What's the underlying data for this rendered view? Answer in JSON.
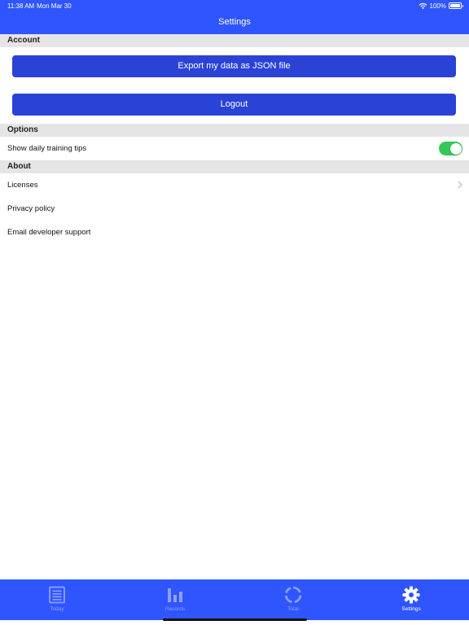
{
  "status_bar": {
    "time": "11:38 AM",
    "date": "Mon Mar 30",
    "battery": "100%",
    "battery_level": 1.0
  },
  "nav": {
    "title": "Settings"
  },
  "sections": {
    "account": {
      "header": "Account",
      "export_button": "Export my data as JSON file",
      "logout_button": "Logout"
    },
    "options": {
      "header": "Options",
      "daily_tips_label": "Show daily training tips",
      "daily_tips_enabled": true
    },
    "about": {
      "header": "About",
      "licenses": "Licenses",
      "privacy": "Privacy policy",
      "email_support": "Email developer support"
    }
  },
  "tabbar": {
    "today": "Today",
    "records": "Records",
    "total": "Total",
    "settings": "Settings",
    "active": "settings"
  },
  "colors": {
    "brand": "#2f55ff",
    "button": "#2a43d6",
    "toggle_on": "#34c759",
    "section_bg": "#e5e5e5",
    "tab_inactive": "#8ea0ff"
  },
  "icons": [
    "wifi-icon",
    "battery-icon",
    "chevron-right-icon",
    "today-icon",
    "records-icon",
    "total-icon",
    "settings-gear-icon"
  ]
}
